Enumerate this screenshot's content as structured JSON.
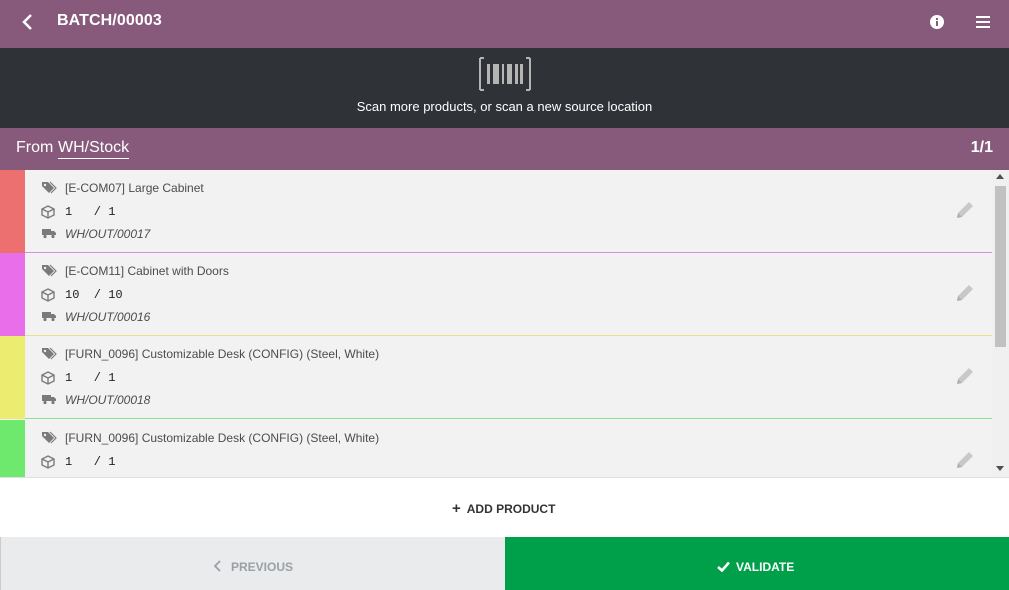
{
  "header": {
    "title": "BATCH/00003",
    "back_icon": "chevron-left-icon",
    "info_icon": "info-circle-icon",
    "menu_icon": "hamburger-menu-icon"
  },
  "scan": {
    "message": "Scan more products, or scan a new source location",
    "icon": "barcode-icon"
  },
  "location": {
    "from_label": "From",
    "name": "WH/Stock",
    "page": "1/1"
  },
  "lines": [
    {
      "product": "[E-COM07] Large Cabinet",
      "qty": "1   / 1",
      "origin": "WH/OUT/00017",
      "color": "#ec7070"
    },
    {
      "product": "[E-COM11] Cabinet with Doors",
      "qty": "10  / 10",
      "origin": "WH/OUT/00016",
      "color": "#e96ee9"
    },
    {
      "product": "[FURN_0096] Customizable Desk (CONFIG) (Steel, White)",
      "qty": "1   / 1",
      "origin": "WH/OUT/00018",
      "color": "#ecec70"
    },
    {
      "product": "[FURN_0096] Customizable Desk (CONFIG) (Steel, White)",
      "qty": "1   / 1",
      "origin": "",
      "color": "#6ee96e"
    }
  ],
  "actions": {
    "add_product": "ADD PRODUCT",
    "previous": "PREVIOUS",
    "validate": "VALIDATE"
  },
  "colors": {
    "brand": "#875a7b",
    "scan_bg": "#2f3237",
    "validate": "#00a04a"
  }
}
